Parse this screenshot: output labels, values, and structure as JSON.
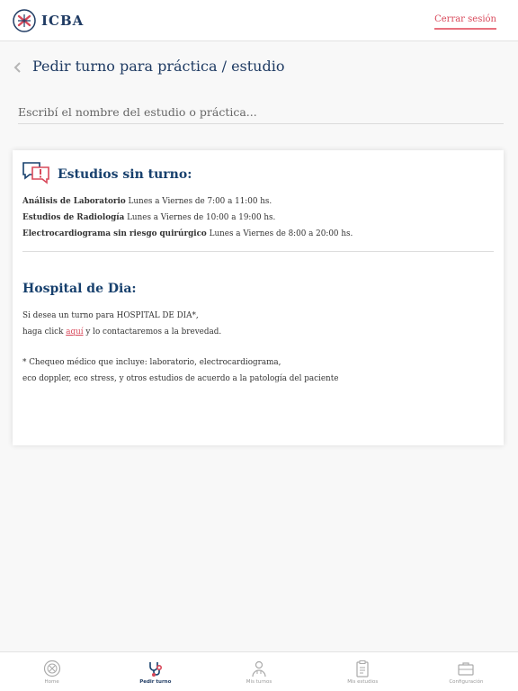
{
  "header": {
    "logo_text": "ICBA",
    "logout_label": "Cerrar sesión"
  },
  "page": {
    "title": "Pedir turno para práctica / estudio"
  },
  "search": {
    "placeholder": "Escribí el nombre del estudio o práctica..."
  },
  "card": {
    "section1_title": "Estudios sin turno:",
    "rows": [
      {
        "name": "Análisis de Laboratorio",
        "schedule": " Lunes a Viernes de 7:00 a 11:00 hs."
      },
      {
        "name": "Estudios de Radiología",
        "schedule": " Lunes a Viernes de 10:00 a 19:00 hs."
      },
      {
        "name": "Electrocardiograma sin riesgo quirúrgico",
        "schedule": " Lunes a Viernes de 8:00 a 20:00 hs."
      }
    ],
    "section2_title": "Hospital de Dia:",
    "hosp_line1": "Si desea un turno para HOSPITAL DE DIA*,",
    "hosp_line2_pre": "haga click ",
    "hosp_link": "aquí",
    "hosp_line2_post": " y lo contactaremos a la brevedad.",
    "note_line1": "* Chequeo médico que incluye: laboratorio, electrocardiograma,",
    "note_line2": "eco doppler, eco stress, y otros estudios de acuerdo a la patología del paciente"
  },
  "nav": {
    "items": [
      {
        "label": "Home",
        "icon": "home-icon"
      },
      {
        "label": "Pedir turno",
        "icon": "stethoscope-icon",
        "active": true
      },
      {
        "label": "Mis turnos",
        "icon": "doctor-icon"
      },
      {
        "label": "Mis estudios",
        "icon": "clipboard-icon"
      },
      {
        "label": "Configuración",
        "icon": "briefcase-icon"
      }
    ]
  },
  "colors": {
    "brand_navy": "#17406d",
    "accent_red": "#d8485a"
  }
}
